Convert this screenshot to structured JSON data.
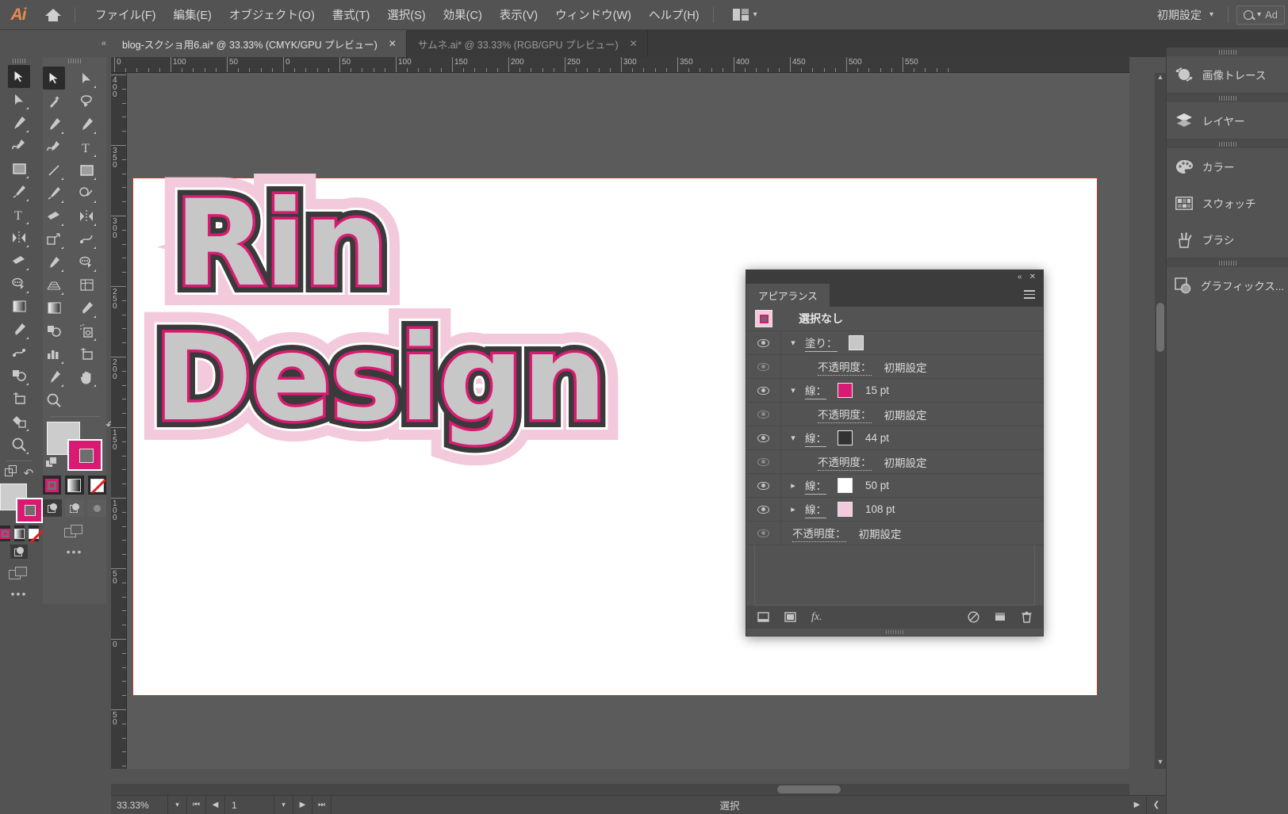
{
  "app": {
    "name": "Ai",
    "logo_color": "#e78b4f"
  },
  "menubar": {
    "items": [
      {
        "label": "ファイル(F)"
      },
      {
        "label": "編集(E)"
      },
      {
        "label": "オブジェクト(O)"
      },
      {
        "label": "書式(T)"
      },
      {
        "label": "選択(S)"
      },
      {
        "label": "効果(C)"
      },
      {
        "label": "表示(V)"
      },
      {
        "label": "ウィンドウ(W)"
      },
      {
        "label": "ヘルプ(H)"
      }
    ],
    "workspace": "初期設定",
    "search_placeholder": "Ad"
  },
  "tabs": [
    {
      "title": "blog-スクショ用6.ai* @ 33.33% (CMYK/GPU プレビュー)",
      "active": true
    },
    {
      "title": "サムネ.ai* @ 33.33% (RGB/GPU プレビュー)",
      "active": false
    }
  ],
  "rulers": {
    "top_labels": [
      "0",
      "100",
      "50",
      "0",
      "50",
      "100",
      "150",
      "200",
      "250",
      "300",
      "350",
      "400",
      "450",
      "500",
      "550"
    ],
    "left_labels": [
      "400",
      "350",
      "300",
      "250",
      "200",
      "150",
      "100",
      "50",
      "0",
      "50"
    ]
  },
  "artwork": {
    "line1": "Rin",
    "line2": "Design",
    "fill_color": "#c7c7c7",
    "stroke_pink": "#d81b72",
    "stroke_dark": "#3a3a3a",
    "stroke_white": "#ffffff",
    "stroke_lightpink": "#f3cadb"
  },
  "toolbar": {
    "fill_color": "#cccccc",
    "stroke_color": "#d81b72"
  },
  "appearance_panel": {
    "tab_label": "アピアランス",
    "selection_label": "選択なし",
    "rows": [
      {
        "name": "塗り：",
        "value": "",
        "swatch": "#c7c7c7",
        "eye": true,
        "expanded": true,
        "kind": "fill"
      },
      {
        "name": "不透明度：",
        "value": "初期設定",
        "eye": false,
        "kind": "opacity"
      },
      {
        "name": "線：",
        "value": "15 pt",
        "swatch": "#d81b72",
        "eye": true,
        "expanded": true,
        "kind": "stroke"
      },
      {
        "name": "不透明度：",
        "value": "初期設定",
        "eye": false,
        "kind": "opacity"
      },
      {
        "name": "線：",
        "value": "44 pt",
        "swatch": "#333333",
        "eye": true,
        "expanded": true,
        "kind": "stroke"
      },
      {
        "name": "不透明度：",
        "value": "初期設定",
        "eye": false,
        "kind": "opacity"
      },
      {
        "name": "線：",
        "value": "50 pt",
        "swatch": "#ffffff",
        "eye": true,
        "expanded": false,
        "kind": "stroke"
      },
      {
        "name": "線：",
        "value": "108 pt",
        "swatch": "#f3cadb",
        "eye": true,
        "expanded": false,
        "kind": "stroke"
      },
      {
        "name": "不透明度：",
        "value": "初期設定",
        "eye": false,
        "kind": "opacity-root"
      }
    ],
    "footer_icons": [
      "add-new-stroke-icon",
      "add-new-fill-icon",
      "add-effect-icon",
      "clear-appearance-icon",
      "duplicate-item-icon",
      "delete-item-icon"
    ]
  },
  "dock": {
    "items": [
      {
        "label": "画像トレース",
        "icon": "image-trace-icon",
        "group": 0
      },
      {
        "label": "レイヤー",
        "icon": "layers-icon",
        "group": 1
      },
      {
        "label": "カラー",
        "icon": "color-icon",
        "group": 2
      },
      {
        "label": "スウォッチ",
        "icon": "swatches-icon",
        "group": 2
      },
      {
        "label": "ブラシ",
        "icon": "brushes-icon",
        "group": 2
      },
      {
        "label": "グラフィックス...",
        "icon": "graphic-styles-icon",
        "group": 3
      }
    ]
  },
  "statusbar": {
    "zoom": "33.33%",
    "page": "1",
    "status_text": "選択"
  }
}
